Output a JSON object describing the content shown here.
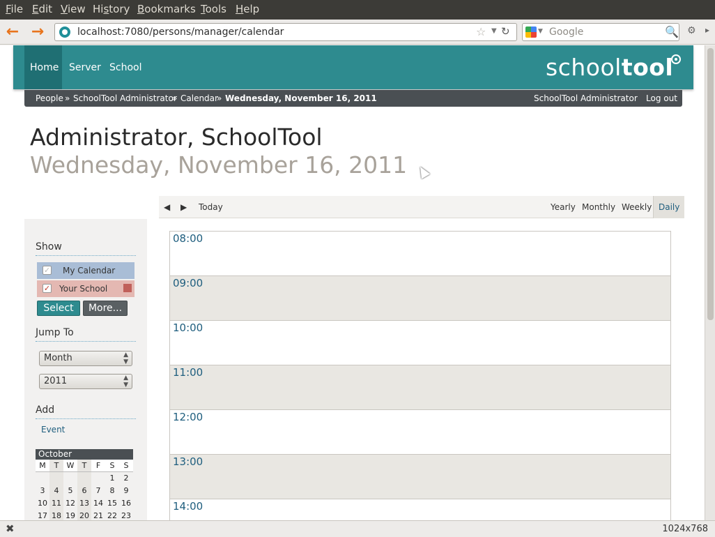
{
  "menubar": {
    "items": [
      {
        "key": "F",
        "rest": "ile"
      },
      {
        "key": "E",
        "rest": "dit"
      },
      {
        "key": "V",
        "rest": "iew"
      },
      {
        "key": "",
        "pre": "Hi",
        "keyMid": "s",
        "rest": "tory"
      },
      {
        "key": "B",
        "rest": "ookmarks"
      },
      {
        "key": "T",
        "rest": "ools"
      },
      {
        "key": "H",
        "rest": "elp"
      }
    ]
  },
  "browser": {
    "url": "localhost:7080/persons/manager/calendar",
    "search_placeholder": "Google",
    "viewport_size": "1024x768"
  },
  "site": {
    "nav": [
      "Home",
      "Server",
      "School"
    ],
    "logo_light": "school",
    "logo_bold": "tool"
  },
  "breadcrumb": {
    "items": [
      "People",
      "»",
      "SchoolTool Administrator",
      "»",
      "Calendar",
      "»",
      "Wednesday, November 16, 2011"
    ],
    "user": "SchoolTool Administrator",
    "logout": "Log out"
  },
  "page": {
    "title": "Administrator, SchoolTool",
    "subtitle": "Wednesday, November 16, 2011"
  },
  "cal_toolbar": {
    "prev": "◀",
    "next": "▶",
    "today": "Today",
    "views": [
      "Yearly",
      "Monthly",
      "Weekly",
      "Daily"
    ],
    "active_view": "Daily"
  },
  "sidebar": {
    "show_heading": "Show",
    "calendars": [
      {
        "label": "My Calendar",
        "checked": true,
        "color": "#a9bdd6"
      },
      {
        "label": "Your School",
        "checked": true,
        "color": "#e4b8b2"
      }
    ],
    "select_btn": "Select",
    "more_btn": "More...",
    "jump_heading": "Jump To",
    "jump_month": "Month",
    "jump_year": "2011",
    "add_heading": "Add",
    "add_event": "Event"
  },
  "mini_calendar": {
    "month": "October",
    "weekdays": [
      "M",
      "T",
      "W",
      "T",
      "F",
      "S",
      "S"
    ],
    "weeks": [
      [
        "",
        "",
        "",
        "",
        "",
        "1",
        "2"
      ],
      [
        "3",
        "4",
        "5",
        "6",
        "7",
        "8",
        "9"
      ],
      [
        "10",
        "11",
        "12",
        "13",
        "14",
        "15",
        "16"
      ],
      [
        "17",
        "18",
        "19",
        "20",
        "21",
        "22",
        "23"
      ]
    ]
  },
  "day_view": {
    "hours": [
      "08:00",
      "09:00",
      "10:00",
      "11:00",
      "12:00",
      "13:00",
      "14:00"
    ]
  }
}
